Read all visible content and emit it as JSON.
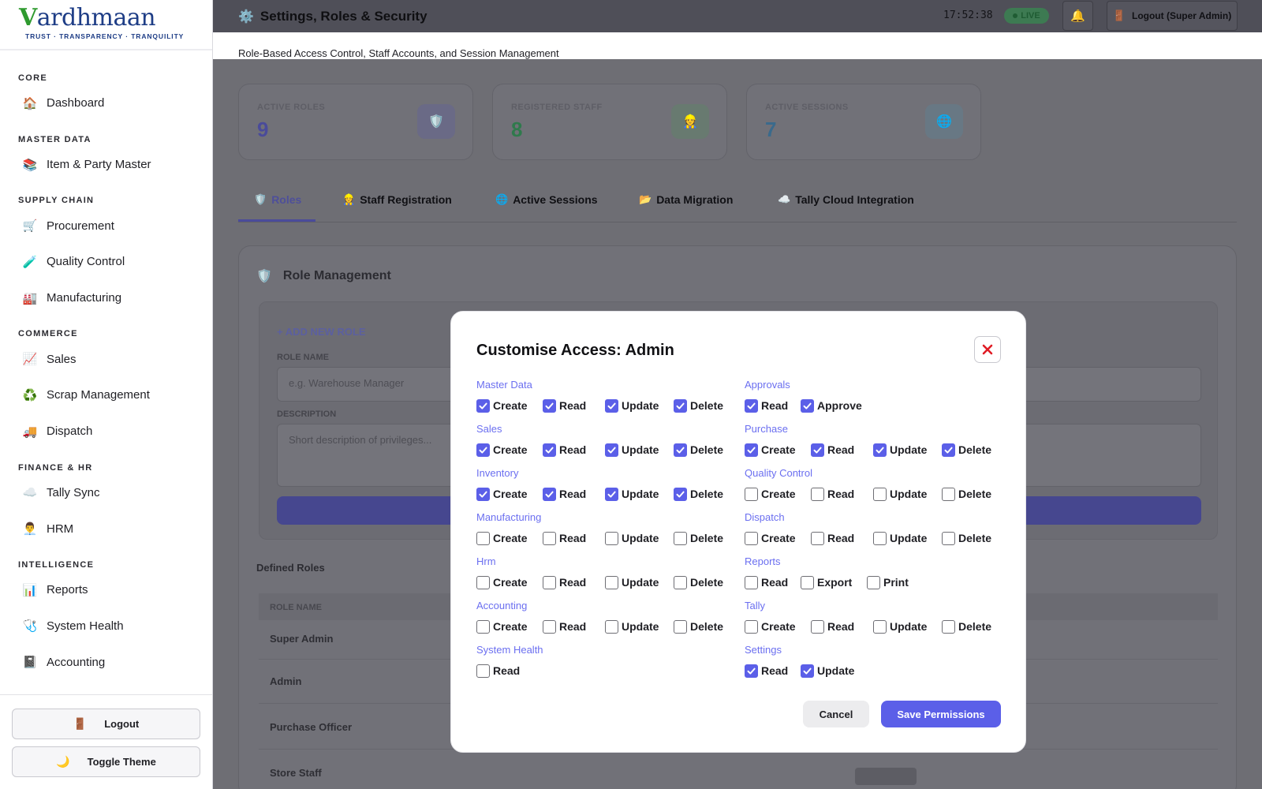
{
  "sidebar": {
    "logo": {
      "word": "ardhmaan",
      "initial": "V",
      "tagline": "TRUST · TRANSPARENCY · TRANQUILITY"
    },
    "sections": [
      {
        "label": "CORE",
        "items": [
          {
            "label": "Dashboard",
            "icon": "home-icon",
            "glyph": "🏠"
          }
        ]
      },
      {
        "label": "MASTER DATA",
        "items": [
          {
            "label": "Item & Party Master",
            "icon": "books-icon",
            "glyph": "📚"
          }
        ]
      },
      {
        "label": "SUPPLY CHAIN",
        "items": [
          {
            "label": "Procurement",
            "icon": "cart-icon",
            "glyph": "🛒"
          },
          {
            "label": "Quality Control",
            "icon": "test-tube-icon",
            "glyph": "🧪"
          },
          {
            "label": "Manufacturing",
            "icon": "factory-icon",
            "glyph": "🏭"
          }
        ]
      },
      {
        "label": "COMMERCE",
        "items": [
          {
            "label": "Sales",
            "icon": "chart-up-icon",
            "glyph": "📈"
          },
          {
            "label": "Scrap Management",
            "icon": "recycle-icon",
            "glyph": "♻️"
          },
          {
            "label": "Dispatch",
            "icon": "truck-icon",
            "glyph": "🚚"
          }
        ]
      },
      {
        "label": "FINANCE & HR",
        "items": [
          {
            "label": "Tally Sync",
            "icon": "cloud-icon",
            "glyph": "☁️"
          },
          {
            "label": "HRM",
            "icon": "person-icon",
            "glyph": "👨‍💼"
          }
        ]
      },
      {
        "label": "INTELLIGENCE",
        "items": [
          {
            "label": "Reports",
            "icon": "bar-chart-icon",
            "glyph": "📊"
          },
          {
            "label": "System Health",
            "icon": "stethoscope-icon",
            "glyph": "🩺"
          },
          {
            "label": "Accounting",
            "icon": "ledger-icon",
            "glyph": "📓"
          }
        ]
      }
    ],
    "logout_label": "Logout",
    "logout_glyph": "🚪",
    "theme_label": "Toggle Theme",
    "theme_glyph": "🌙"
  },
  "topbar": {
    "gear_glyph": "⚙️",
    "title": "Settings, Roles & Security",
    "clock": "17:52:38",
    "live_label": "LIVE",
    "bell_glyph": "🔔",
    "logout_label": "Logout (Super Admin)",
    "logout_glyph": "🚪",
    "subtitle": "Role-Based Access Control, Staff Accounts, and Session Management"
  },
  "stats": [
    {
      "label": "ACTIVE ROLES",
      "value": "9",
      "glyph": "🛡️",
      "color": "#4a4b9a",
      "bg": "#6a6a86"
    },
    {
      "label": "REGISTERED STAFF",
      "value": "8",
      "glyph": "👷",
      "color": "#2f7a4c",
      "bg": "#687a70"
    },
    {
      "label": "ACTIVE SESSIONS",
      "value": "7",
      "glyph": "🌐",
      "color": "#3a6a8c",
      "bg": "#687884"
    }
  ],
  "tabs": [
    {
      "label": "Roles",
      "glyph": "🛡️"
    },
    {
      "label": "Staff Registration",
      "glyph": "👷"
    },
    {
      "label": "Active Sessions",
      "glyph": "🌐"
    },
    {
      "label": "Data Migration",
      "glyph": "📂"
    },
    {
      "label": "Tally Cloud Integration",
      "glyph": "☁️"
    }
  ],
  "role_panel": {
    "title": "Role Management",
    "title_glyph": "🛡️",
    "add_link": "+ ADD NEW ROLE",
    "role_name_label": "ROLE NAME",
    "role_name_placeholder": "e.g. Warehouse Manager",
    "description_label": "DESCRIPTION",
    "description_placeholder": "Short description of privileges...",
    "defined_title": "Defined Roles",
    "table_header": "ROLE NAME",
    "rows": [
      "Super Admin",
      "Admin",
      "Purchase Officer",
      "Store Staff"
    ]
  },
  "modal": {
    "title": "Customise Access: Admin",
    "close_glyph": "✕",
    "cancel_label": "Cancel",
    "save_label": "Save Permissions",
    "left_groups": [
      {
        "name": "Master Data",
        "perms": [
          {
            "label": "Create",
            "checked": true
          },
          {
            "label": "Read",
            "checked": true
          },
          {
            "label": "Update",
            "checked": true
          },
          {
            "label": "Delete",
            "checked": true
          }
        ]
      },
      {
        "name": "Sales",
        "perms": [
          {
            "label": "Create",
            "checked": true
          },
          {
            "label": "Read",
            "checked": true
          },
          {
            "label": "Update",
            "checked": true
          },
          {
            "label": "Delete",
            "checked": true
          }
        ]
      },
      {
        "name": "Inventory",
        "perms": [
          {
            "label": "Create",
            "checked": true
          },
          {
            "label": "Read",
            "checked": true
          },
          {
            "label": "Update",
            "checked": true
          },
          {
            "label": "Delete",
            "checked": true
          }
        ]
      },
      {
        "name": "Manufacturing",
        "perms": [
          {
            "label": "Create",
            "checked": false
          },
          {
            "label": "Read",
            "checked": false
          },
          {
            "label": "Update",
            "checked": false
          },
          {
            "label": "Delete",
            "checked": false
          }
        ]
      },
      {
        "name": "Hrm",
        "perms": [
          {
            "label": "Create",
            "checked": false
          },
          {
            "label": "Read",
            "checked": false
          },
          {
            "label": "Update",
            "checked": false
          },
          {
            "label": "Delete",
            "checked": false
          }
        ]
      },
      {
        "name": "Accounting",
        "perms": [
          {
            "label": "Create",
            "checked": false
          },
          {
            "label": "Read",
            "checked": false
          },
          {
            "label": "Update",
            "checked": false
          },
          {
            "label": "Delete",
            "checked": false
          }
        ]
      },
      {
        "name": "System Health",
        "perms": [
          {
            "label": "Read",
            "checked": false
          }
        ]
      }
    ],
    "right_groups": [
      {
        "name": "Approvals",
        "perms": [
          {
            "label": "Read",
            "checked": true
          },
          {
            "label": "Approve",
            "checked": true
          }
        ]
      },
      {
        "name": "Purchase",
        "perms": [
          {
            "label": "Create",
            "checked": true
          },
          {
            "label": "Read",
            "checked": true
          },
          {
            "label": "Update",
            "checked": true
          },
          {
            "label": "Delete",
            "checked": true
          }
        ]
      },
      {
        "name": "Quality Control",
        "perms": [
          {
            "label": "Create",
            "checked": false
          },
          {
            "label": "Read",
            "checked": false
          },
          {
            "label": "Update",
            "checked": false
          },
          {
            "label": "Delete",
            "checked": false
          }
        ]
      },
      {
        "name": "Dispatch",
        "perms": [
          {
            "label": "Create",
            "checked": false
          },
          {
            "label": "Read",
            "checked": false
          },
          {
            "label": "Update",
            "checked": false
          },
          {
            "label": "Delete",
            "checked": false
          }
        ]
      },
      {
        "name": "Reports",
        "perms": [
          {
            "label": "Read",
            "checked": false
          },
          {
            "label": "Export",
            "checked": false
          },
          {
            "label": "Print",
            "checked": false
          }
        ]
      },
      {
        "name": "Tally",
        "perms": [
          {
            "label": "Create",
            "checked": false
          },
          {
            "label": "Read",
            "checked": false
          },
          {
            "label": "Update",
            "checked": false
          },
          {
            "label": "Delete",
            "checked": false
          }
        ]
      },
      {
        "name": "Settings",
        "perms": [
          {
            "label": "Read",
            "checked": true
          },
          {
            "label": "Update",
            "checked": true
          }
        ]
      }
    ]
  }
}
